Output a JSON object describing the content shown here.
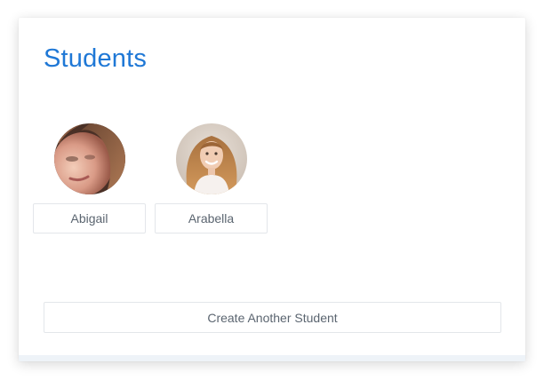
{
  "page": {
    "title": "Students"
  },
  "students": [
    {
      "name": "Abigail",
      "avatar": "student-photo"
    },
    {
      "name": "Arabella",
      "avatar": "student-photo"
    }
  ],
  "actions": {
    "create_label": "Create Another Student"
  },
  "colors": {
    "accent": "#1f78d6",
    "text_muted": "#5b6570",
    "border": "#e3e6ea"
  }
}
